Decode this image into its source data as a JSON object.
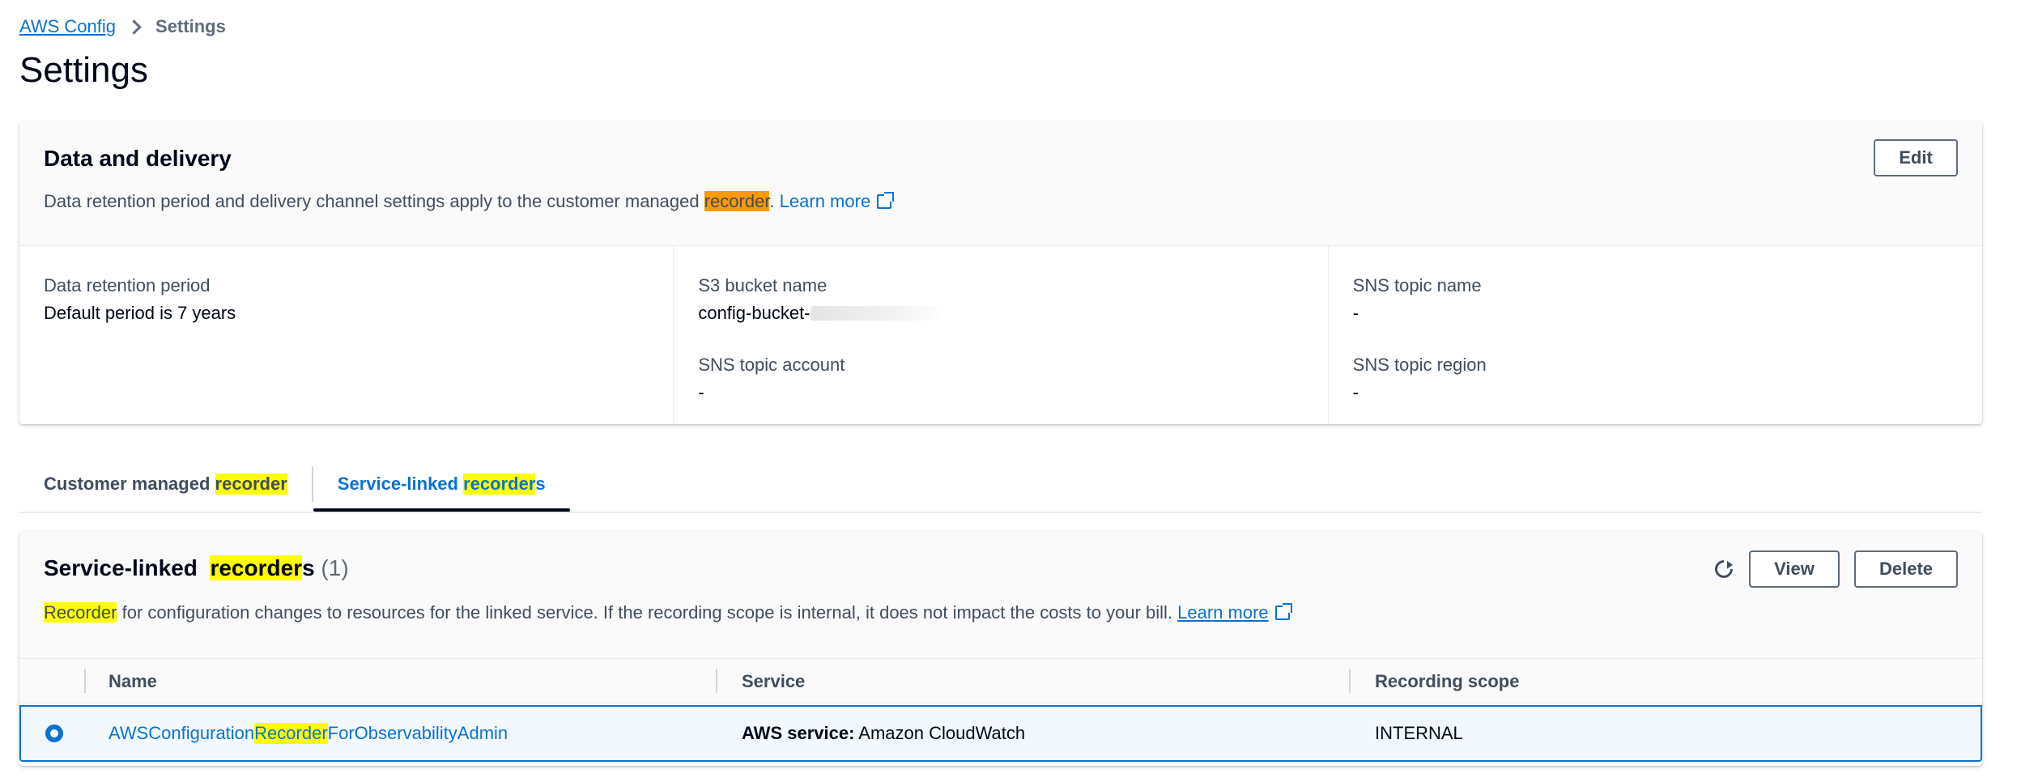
{
  "breadcrumb": {
    "parent": "AWS Config",
    "current": "Settings"
  },
  "page_title": "Settings",
  "data_delivery": {
    "title": "Data and delivery",
    "desc_before": "Data retention period and delivery channel settings apply to the customer managed ",
    "desc_highlight": "recorder",
    "desc_after": ". ",
    "learn_more": "Learn more",
    "edit_label": "Edit",
    "retention_label": "Data retention period",
    "retention_value": "Default period is 7 years",
    "s3_label": "S3 bucket name",
    "s3_value": "config-bucket-",
    "sns_account_label": "SNS topic account",
    "sns_account_value": "-",
    "sns_name_label": "SNS topic name",
    "sns_name_value": "-",
    "sns_region_label": "SNS topic region",
    "sns_region_value": "-"
  },
  "tabs": {
    "customer_prefix": "Customer managed ",
    "customer_highlight": "recorder",
    "service_prefix": "Service-linked ",
    "service_highlight": "recorder",
    "service_suffix": "s"
  },
  "service_linked": {
    "title_prefix": "Service-linked ",
    "title_highlight": "recorder",
    "title_suffix": "s",
    "count": "(1)",
    "view_label": "View",
    "delete_label": "Delete",
    "desc_highlight": "Recorder",
    "desc_text": " for configuration changes to resources for the linked service. If the recording scope is internal, it does not impact the costs to your bill. ",
    "learn_more": "Learn more",
    "columns": {
      "name": "Name",
      "service": "Service",
      "scope": "Recording scope"
    },
    "row": {
      "name_prefix": "AWSConfiguration",
      "name_highlight": "Recorder",
      "name_suffix": "ForObservabilityAdmin",
      "service_label": "AWS service:",
      "service_value": " Amazon CloudWatch",
      "scope": "INTERNAL"
    }
  }
}
